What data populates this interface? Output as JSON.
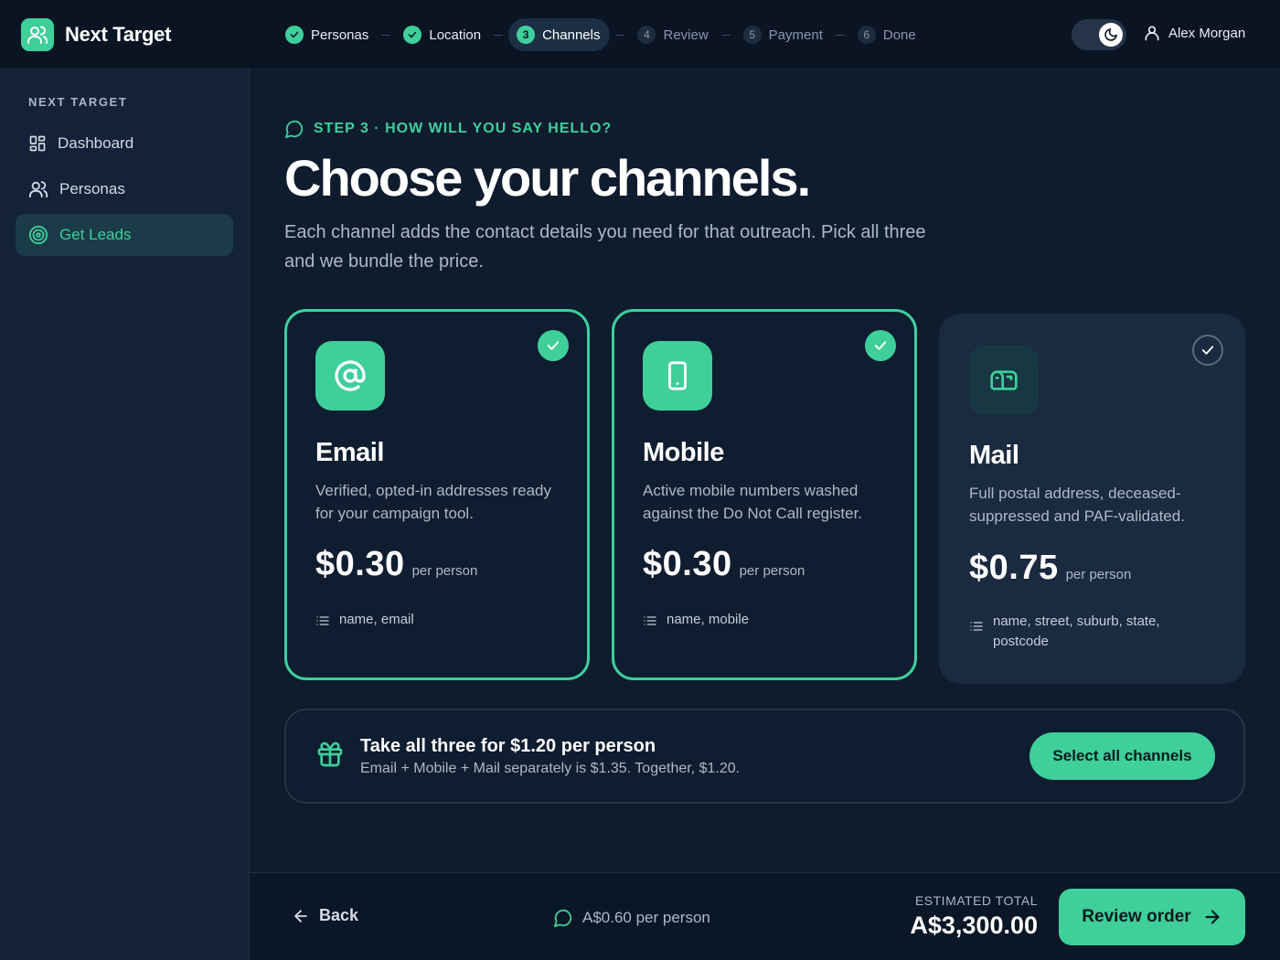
{
  "app": {
    "name": "Next Target"
  },
  "stepper": {
    "steps": [
      {
        "label": "Personas",
        "state": "done"
      },
      {
        "label": "Location",
        "state": "done"
      },
      {
        "label": "Channels",
        "number": "3",
        "state": "current"
      },
      {
        "label": "Review",
        "number": "4",
        "state": "todo"
      },
      {
        "label": "Payment",
        "number": "5",
        "state": "todo"
      },
      {
        "label": "Done",
        "number": "6",
        "state": "todo"
      }
    ]
  },
  "header": {
    "theme_icon": "moon-icon",
    "user_name": "Alex Morgan"
  },
  "sidebar": {
    "heading": "NEXT TARGET",
    "items": [
      {
        "label": "Dashboard",
        "icon": "dashboard-icon",
        "active": false
      },
      {
        "label": "Personas",
        "icon": "users-icon",
        "active": false
      },
      {
        "label": "Get Leads",
        "icon": "target-icon",
        "active": true
      }
    ]
  },
  "main": {
    "eyebrow": "STEP 3 · HOW WILL YOU SAY HELLO?",
    "title": "Choose your channels.",
    "subtitle": "Each channel adds the contact details you need for that outreach. Pick all three and we bundle the price."
  },
  "channels": [
    {
      "name": "Email",
      "icon": "at-sign-icon",
      "selected": true,
      "description": "Verified, opted-in addresses ready for your campaign tool.",
      "price": "$0.30",
      "unit": "per person",
      "fields": "name, email"
    },
    {
      "name": "Mobile",
      "icon": "smartphone-icon",
      "selected": true,
      "description": "Active mobile numbers washed against the Do Not Call register.",
      "price": "$0.30",
      "unit": "per person",
      "fields": "name, mobile"
    },
    {
      "name": "Mail",
      "icon": "mailbox-icon",
      "selected": false,
      "description": "Full postal address, deceased-suppressed and PAF-validated.",
      "price": "$0.75",
      "unit": "per person",
      "fields": "name, street, suburb, state, postcode"
    }
  ],
  "bundle": {
    "icon": "gift-icon",
    "title": "Take all three for $1.20 per person",
    "text": "Email + Mobile + Mail separately is $1.35. Together, $1.20.",
    "button": "Select all channels"
  },
  "footer": {
    "back": "Back",
    "per_person": "A$0.60 per person",
    "estimate_label": "ESTIMATED TOTAL",
    "estimate_value": "A$3,300.00",
    "review_button": "Review order"
  },
  "colors": {
    "accent": "#3ecf9b",
    "background": "#0f1c2e",
    "card": "#0f1d30"
  }
}
